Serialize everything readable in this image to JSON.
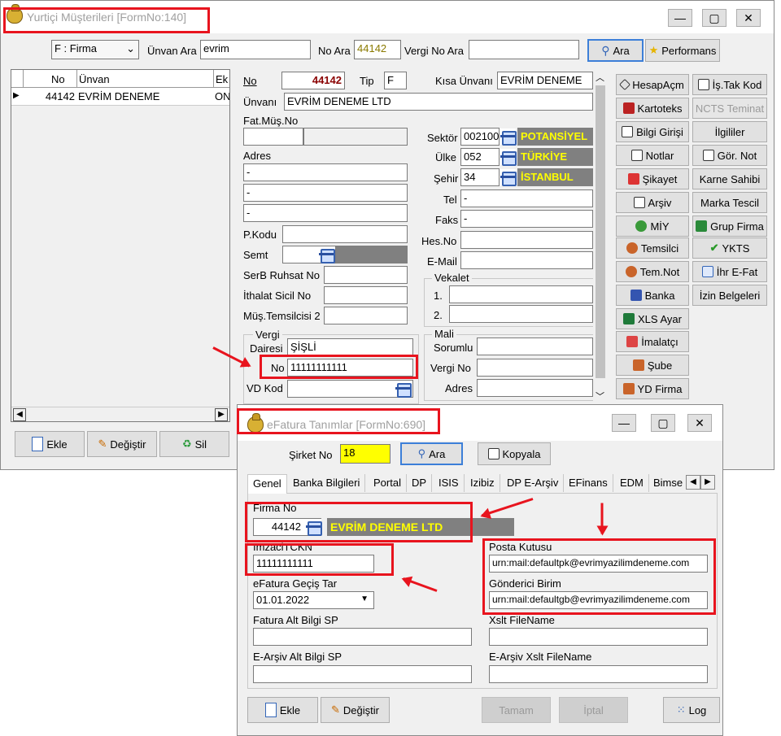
{
  "main_window": {
    "title": "Yurtiçi Müşterileri [FormNo:140]",
    "min_btn": "▭",
    "max_btn": "▢",
    "close_btn": "✕"
  },
  "search": {
    "type_select": "F : Firma",
    "unvan_label": "Ünvan Ara",
    "unvan_value": "evrim",
    "no_label": "No Ara",
    "no_value": "44142",
    "vergi_label": "Vergi No Ara",
    "vergi_value": "",
    "ara_button": "Ara",
    "performans_button": "Performans"
  },
  "grid": {
    "columns": [
      "No",
      "Ünvan",
      "Ek"
    ],
    "rows": [
      {
        "no": "44142",
        "unvan": "EVRİM DENEME",
        "ek": "ON"
      }
    ]
  },
  "form": {
    "no_label": "No",
    "no_value": "44142",
    "tip_label": "Tip",
    "tip_value": "F",
    "kisa_unvan_label": "Kısa Ünvanı",
    "kisa_unvan_value": "EVRİM DENEME",
    "unvani_label": "Ünvanı",
    "unvani_value": "EVRİM DENEME LTD",
    "fat_mus_no_label": "Fat.Müş.No",
    "adres_label": "Adres",
    "adres1": "-",
    "adres2": "-",
    "adres3": "-",
    "pkodu_label": "P.Kodu",
    "semt_label": "Semt",
    "serb_label": "SerB Ruhsat No",
    "ithalat_label": "İthalat Sicil No",
    "temsilci_label": "Müş.Temsilcisi 2",
    "vergi_group": "Vergi",
    "vergi_dairesi_label": "Dairesi",
    "vergi_dairesi_value": "ŞİŞLİ",
    "vergi_no_label": "No",
    "vergi_no_value": "11111111111",
    "vd_kod_label": "VD Kod",
    "sektor_label": "Sektör",
    "sektor_code": "002100",
    "sektor_name": "POTANSİYEL",
    "ulke_label": "Ülke",
    "ulke_code": "052",
    "ulke_name": "TÜRKİYE",
    "sehir_label": "Şehir",
    "sehir_code": "34",
    "sehir_name": "İSTANBUL",
    "tel_label": "Tel",
    "tel_value": "-",
    "faks_label": "Faks",
    "faks_value": "-",
    "hesno_label": "Hes.No",
    "email_label": "E-Mail",
    "vekalet_group": "Vekalet",
    "vekalet_1": "1.",
    "vekalet_2": "2.",
    "mali_group": "Mali",
    "mali_sorumlu": "Sorumlu",
    "mali_vergi_no": "Vergi No",
    "mali_adres": "Adres"
  },
  "side_buttons_left": [
    "HesapAçm",
    "Kartoteks",
    "Bilgi Girişi",
    "Notlar",
    "Şikayet",
    "Arşiv",
    "MİY",
    "Temsilci",
    "Tem.Not",
    "Banka",
    "XLS Ayar",
    "İmalatçı",
    "Şube",
    "YD Firma"
  ],
  "side_buttons_right": [
    "İş.Tak Kod",
    "NCTS Teminat",
    "İlgililer",
    "Gör. Not",
    "Karne Sahibi",
    "Marka Tescil",
    "Grup Firma",
    "YKTS",
    "İhr E-Fat",
    "İzin Belgeleri"
  ],
  "bottom_buttons": {
    "ekle": "Ekle",
    "degistir": "Değiştir",
    "sil": "Sil"
  },
  "efatura": {
    "title": "eFatura Tanımlar [FormNo:690]",
    "sirket_no_label": "Şirket No",
    "sirket_no_value": "18",
    "ara_button": "Ara",
    "kopyala_button": "Kopyala",
    "tabs": [
      "Genel",
      "Banka Bilgileri",
      "Portal",
      "DP",
      "ISIS",
      "Izibiz",
      "DP E-Arşiv",
      "EFinans",
      "EDM",
      "Bimse"
    ],
    "firma_no_label": "Firma No",
    "firma_no_value": "44142",
    "firma_name": "EVRİM DENEME LTD",
    "imzaci_label": "ImzaciTCKN",
    "imzaci_value": "11111111111",
    "gecis_label": "eFatura Geçiş Tar",
    "gecis_value": "01.01.2022",
    "fatura_alt_label": "Fatura Alt Bilgi SP",
    "earsiv_alt_label": "E-Arşiv Alt Bilgi SP",
    "posta_label": "Posta Kutusu",
    "posta_value": "urn:mail:defaultpk@evrimyazilimdeneme.com",
    "gonderici_label": "Gönderici Birim",
    "gonderici_value": "urn:mail:defaultgb@evrimyazilimdeneme.com",
    "xslt_label": "Xslt FileName",
    "earsiv_xslt_label": "E-Arşiv Xslt FileName",
    "ekle_button": "Ekle",
    "degistir_button": "Değiştir",
    "tamam_button": "Tamam",
    "iptal_button": "İptal",
    "log_button": "Log"
  }
}
